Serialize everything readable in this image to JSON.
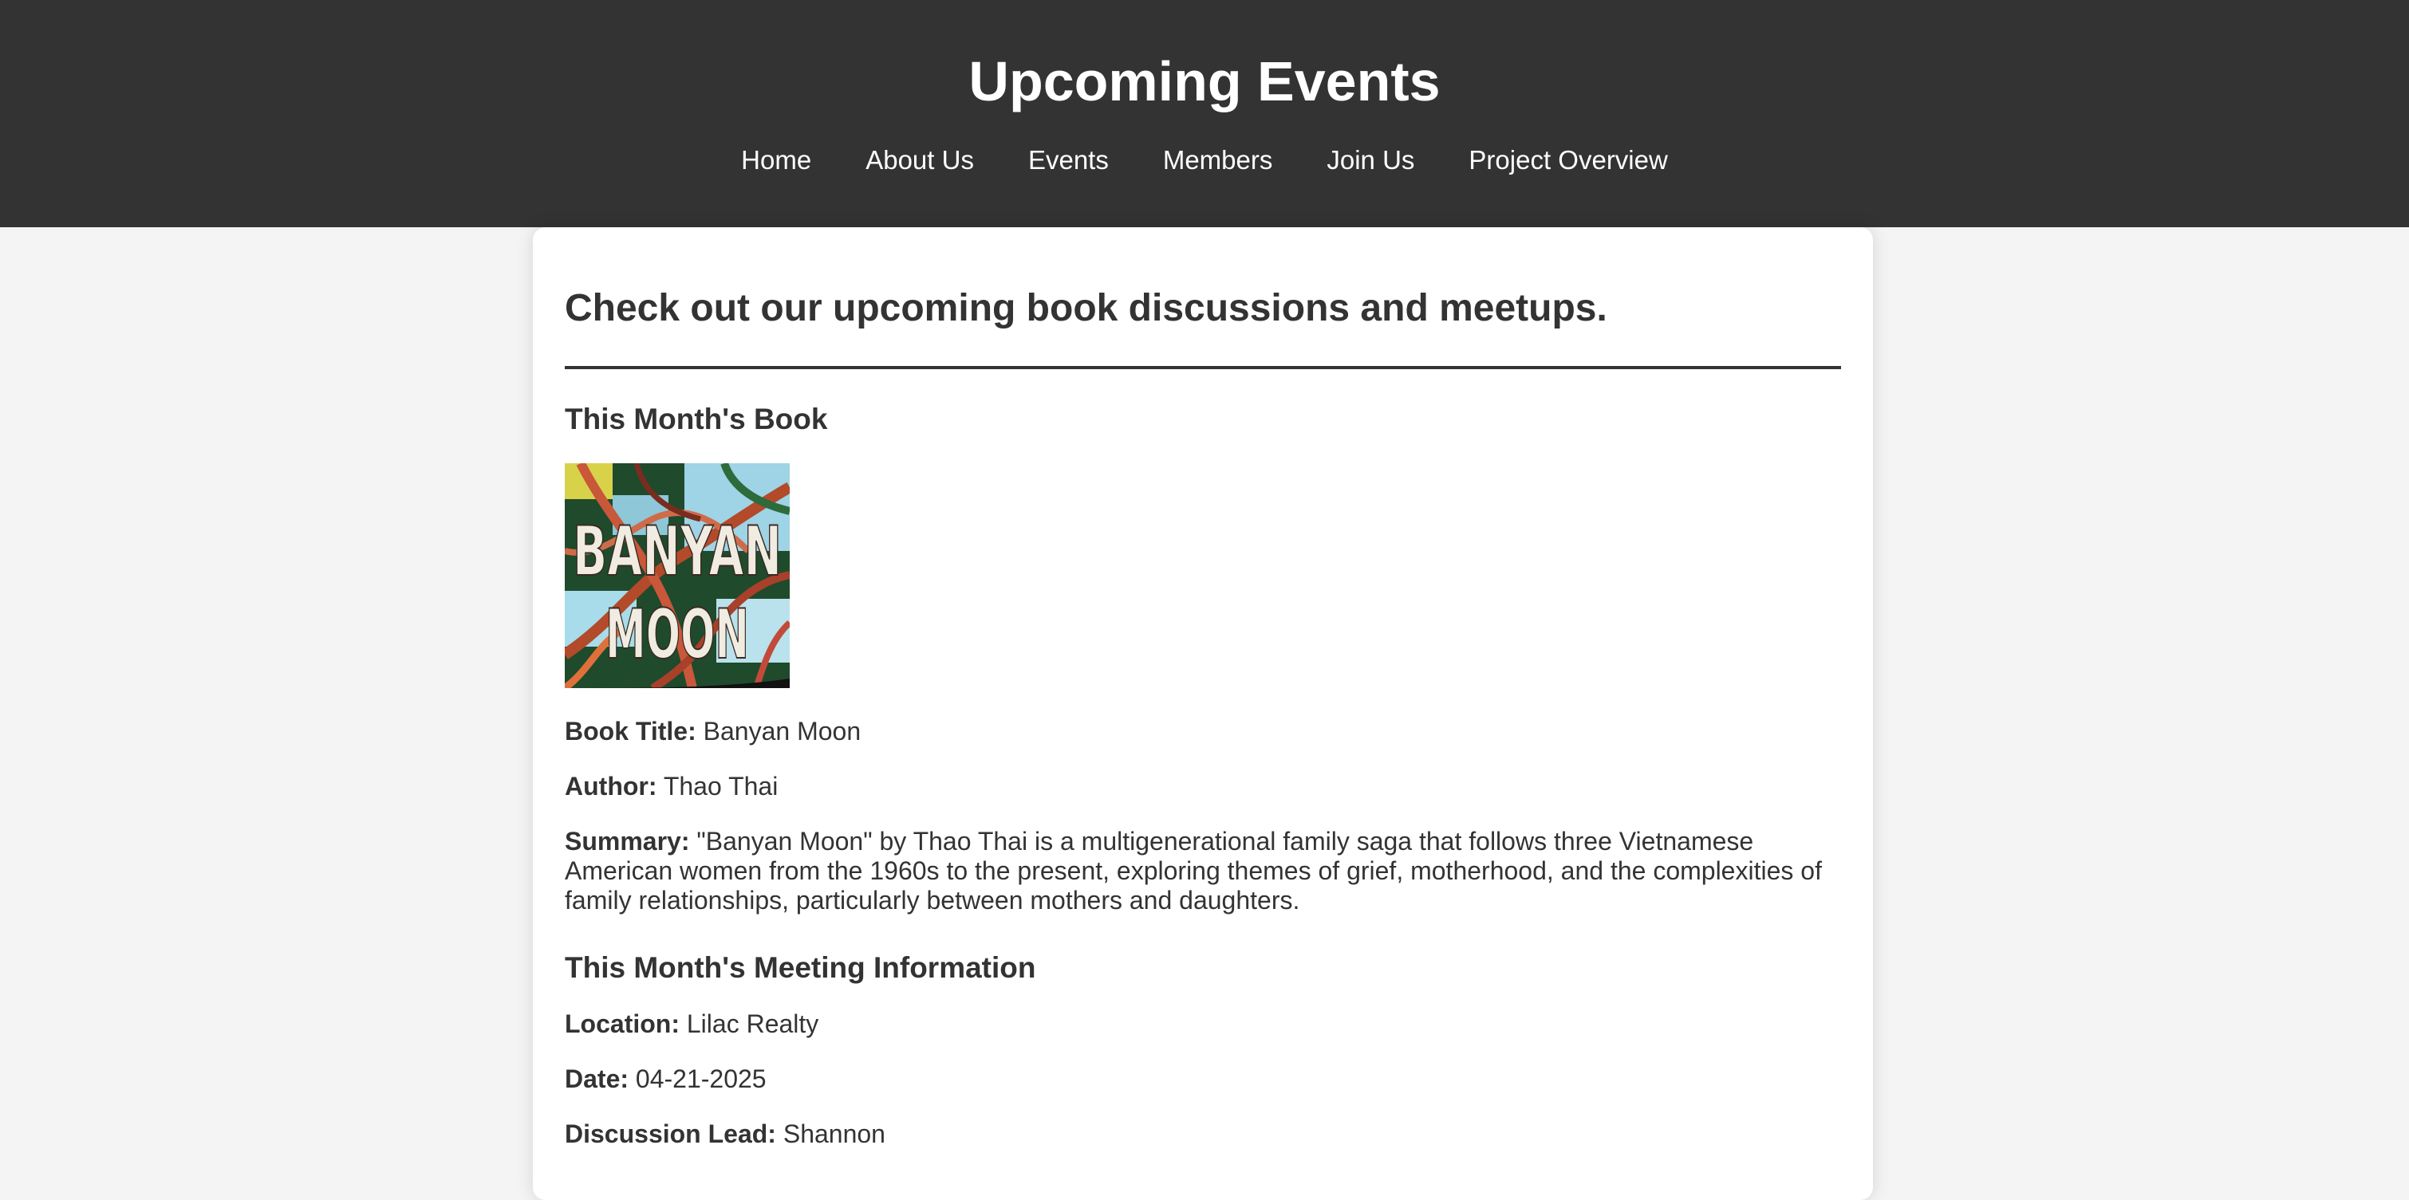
{
  "header": {
    "title": "Upcoming Events",
    "nav": [
      {
        "label": "Home"
      },
      {
        "label": "About Us"
      },
      {
        "label": "Events"
      },
      {
        "label": "Members"
      },
      {
        "label": "Join Us"
      },
      {
        "label": "Project Overview"
      }
    ]
  },
  "main": {
    "intro": "Check out our upcoming book discussions and meetups.",
    "book_section": {
      "heading": "This Month's Book",
      "cover_text": [
        "BANYAN",
        "MOON"
      ],
      "cover_alt": "Banyan Moon",
      "title_label": "Book Title:",
      "title_value": " Banyan Moon",
      "author_label": "Author:",
      "author_value": " Thao Thai",
      "summary_label": "Summary:",
      "summary_value": " \"Banyan Moon\" by Thao Thai is a multigenerational family saga that follows three Vietnamese American women from the 1960s to the present, exploring themes of grief, motherhood, and the complexities of family relationships, particularly between mothers and daughters."
    },
    "meeting_section": {
      "heading": "This Month's Meeting Information",
      "location_label": "Location:",
      "location_value": " Lilac Realty",
      "date_label": "Date:",
      "date_value": " 04-21-2025",
      "lead_label": "Discussion Lead:",
      "lead_value": " Shannon"
    }
  },
  "colors": {
    "header_bg": "#333333",
    "page_bg": "#f4f4f4",
    "card_bg": "#ffffff",
    "text": "#333333"
  }
}
